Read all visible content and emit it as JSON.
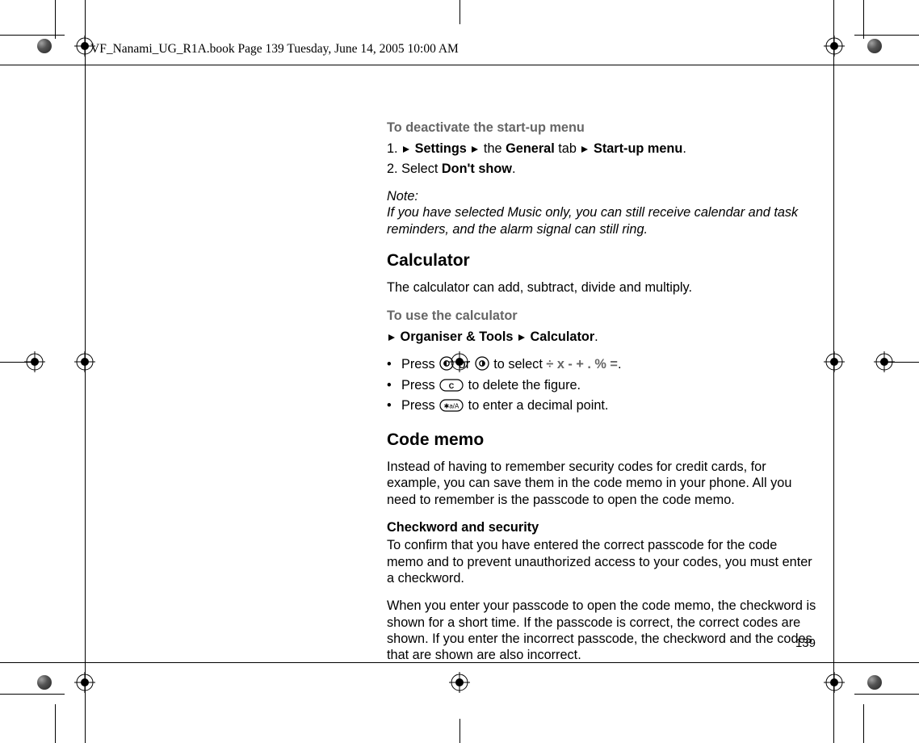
{
  "header": {
    "filename": "VF_Nanami_UG_R1A.book  Page 139  Tuesday, June 14, 2005  10:00 AM"
  },
  "page_number": "139",
  "content": {
    "h_deactivate": "To deactivate the start-up menu",
    "step1_pre": "1. ",
    "step1_settings": "Settings",
    "step1_the": " the ",
    "step1_general": "General",
    "step1_tab": " tab ",
    "step1_startup": "Start-up menu",
    "step1_period": ".",
    "step2_pre": "2. Select ",
    "step2_dontshow": "Don't show",
    "step2_period": ".",
    "note_label": "Note:",
    "note_body": "If you have selected Music only, you can still receive calendar and task reminders, and the alarm signal can still ring.",
    "h_calculator": "Calculator",
    "calc_intro": "The calculator can add, subtract, divide and multiply.",
    "h_use_calc": "To use the calculator",
    "calc_path_org": "Organiser & Tools",
    "calc_path_calc": "Calculator",
    "calc_path_period": ".",
    "calc_b1_press": "Press ",
    "calc_b1_or": " or ",
    "calc_b1_select": " to select ",
    "calc_b1_ops": "÷ x - + . % =",
    "calc_b1_period": ".",
    "calc_b2_press": "Press ",
    "calc_b2_rest": " to delete the figure.",
    "calc_b3_press": "Press ",
    "calc_b3_rest": " to enter a decimal point.",
    "h_codememo": "Code memo",
    "codememo_intro": "Instead of having to remember security codes for credit cards, for example, you can save them in the code memo in your phone. All you need to remember is the passcode to open the code memo.",
    "h_checkword": "Checkword and security",
    "checkword_p1": "To confirm that you have entered the correct passcode for the code memo and to prevent unauthorized access to your codes, you must enter a checkword.",
    "checkword_p2": "When you enter your passcode to open the code memo, the checkword is shown for a short time. If the passcode is correct, the correct codes are shown. If you enter the incorrect passcode, the checkword and the codes that are shown are also incorrect."
  }
}
